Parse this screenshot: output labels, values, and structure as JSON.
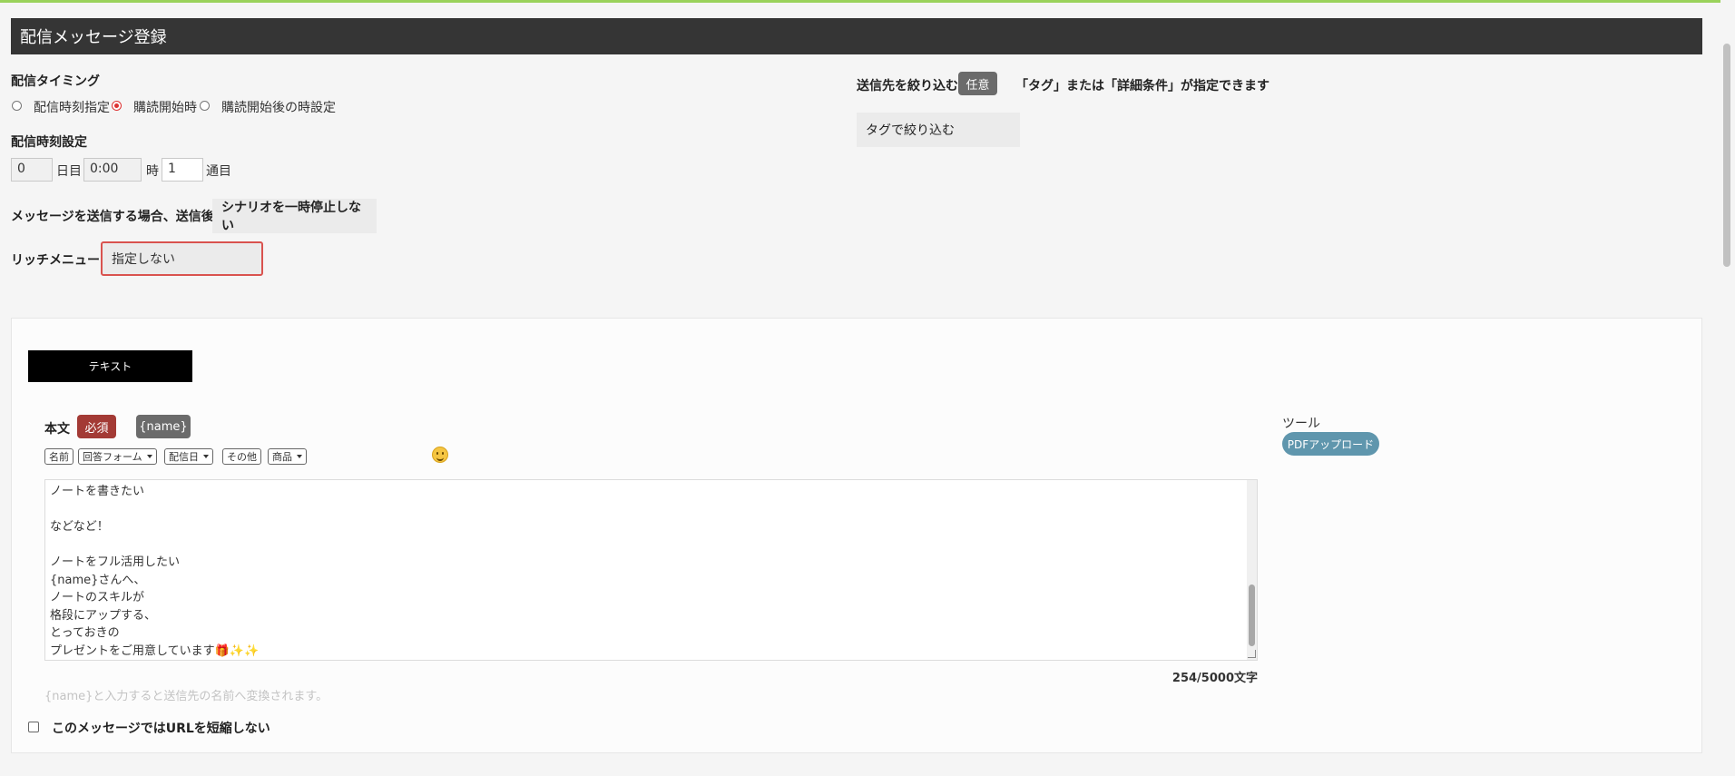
{
  "header": {
    "title": "配信メッセージ登録"
  },
  "timing": {
    "label": "配信タイミング",
    "options": [
      {
        "label": "配信時刻指定",
        "checked": false
      },
      {
        "label": "購読開始時",
        "checked": true
      },
      {
        "label": "購読開始後の時設定",
        "checked": false
      }
    ]
  },
  "time_setting": {
    "label": "配信時刻設定",
    "day_value": "0",
    "day_unit": "日目",
    "time_value": "0:00",
    "time_unit": "時",
    "week_value": "1",
    "week_unit": "通目"
  },
  "after_send": {
    "label": "メッセージを送信する場合、送信後に",
    "value": "シナリオを一時停止しない"
  },
  "rich_menu": {
    "label": "リッチメニュー",
    "value": "指定しない"
  },
  "filter": {
    "label": "送信先を絞り込む",
    "badge": "任意",
    "note": "「タグ」または「詳細条件」が指定できます",
    "tag_button": "タグで絞り込む"
  },
  "editor": {
    "tab_label": "テキスト",
    "body_label": "本文",
    "required_badge": "必須",
    "name_badge": "{name}",
    "tool_buttons": [
      "名前",
      "回答フォーム",
      "配信日",
      "その他",
      "商品"
    ],
    "text_lines": [
      "ノートを書きたい",
      "",
      "などなど！",
      "",
      "ノートをフル活用したい",
      "{name}さんへ、",
      "ノートのスキルが",
      "格段にアップする、",
      "とっておきの",
      "プレゼントをご用意しています🎁✨✨"
    ],
    "counter": "254/5000文字",
    "hint": "{name}と入力すると送信先の名前へ変換されます。",
    "checkbox_label": "このメッセージではURLを短縮しない"
  },
  "tools": {
    "label": "ツール",
    "pdf_button": "PDFアップロード"
  },
  "colors": {
    "accent_green": "#9ad25b",
    "header_bg": "#353535",
    "required_red": "#a33a35",
    "pdf_blue": "#5f96ad",
    "rich_menu_border": "#d9534f"
  }
}
